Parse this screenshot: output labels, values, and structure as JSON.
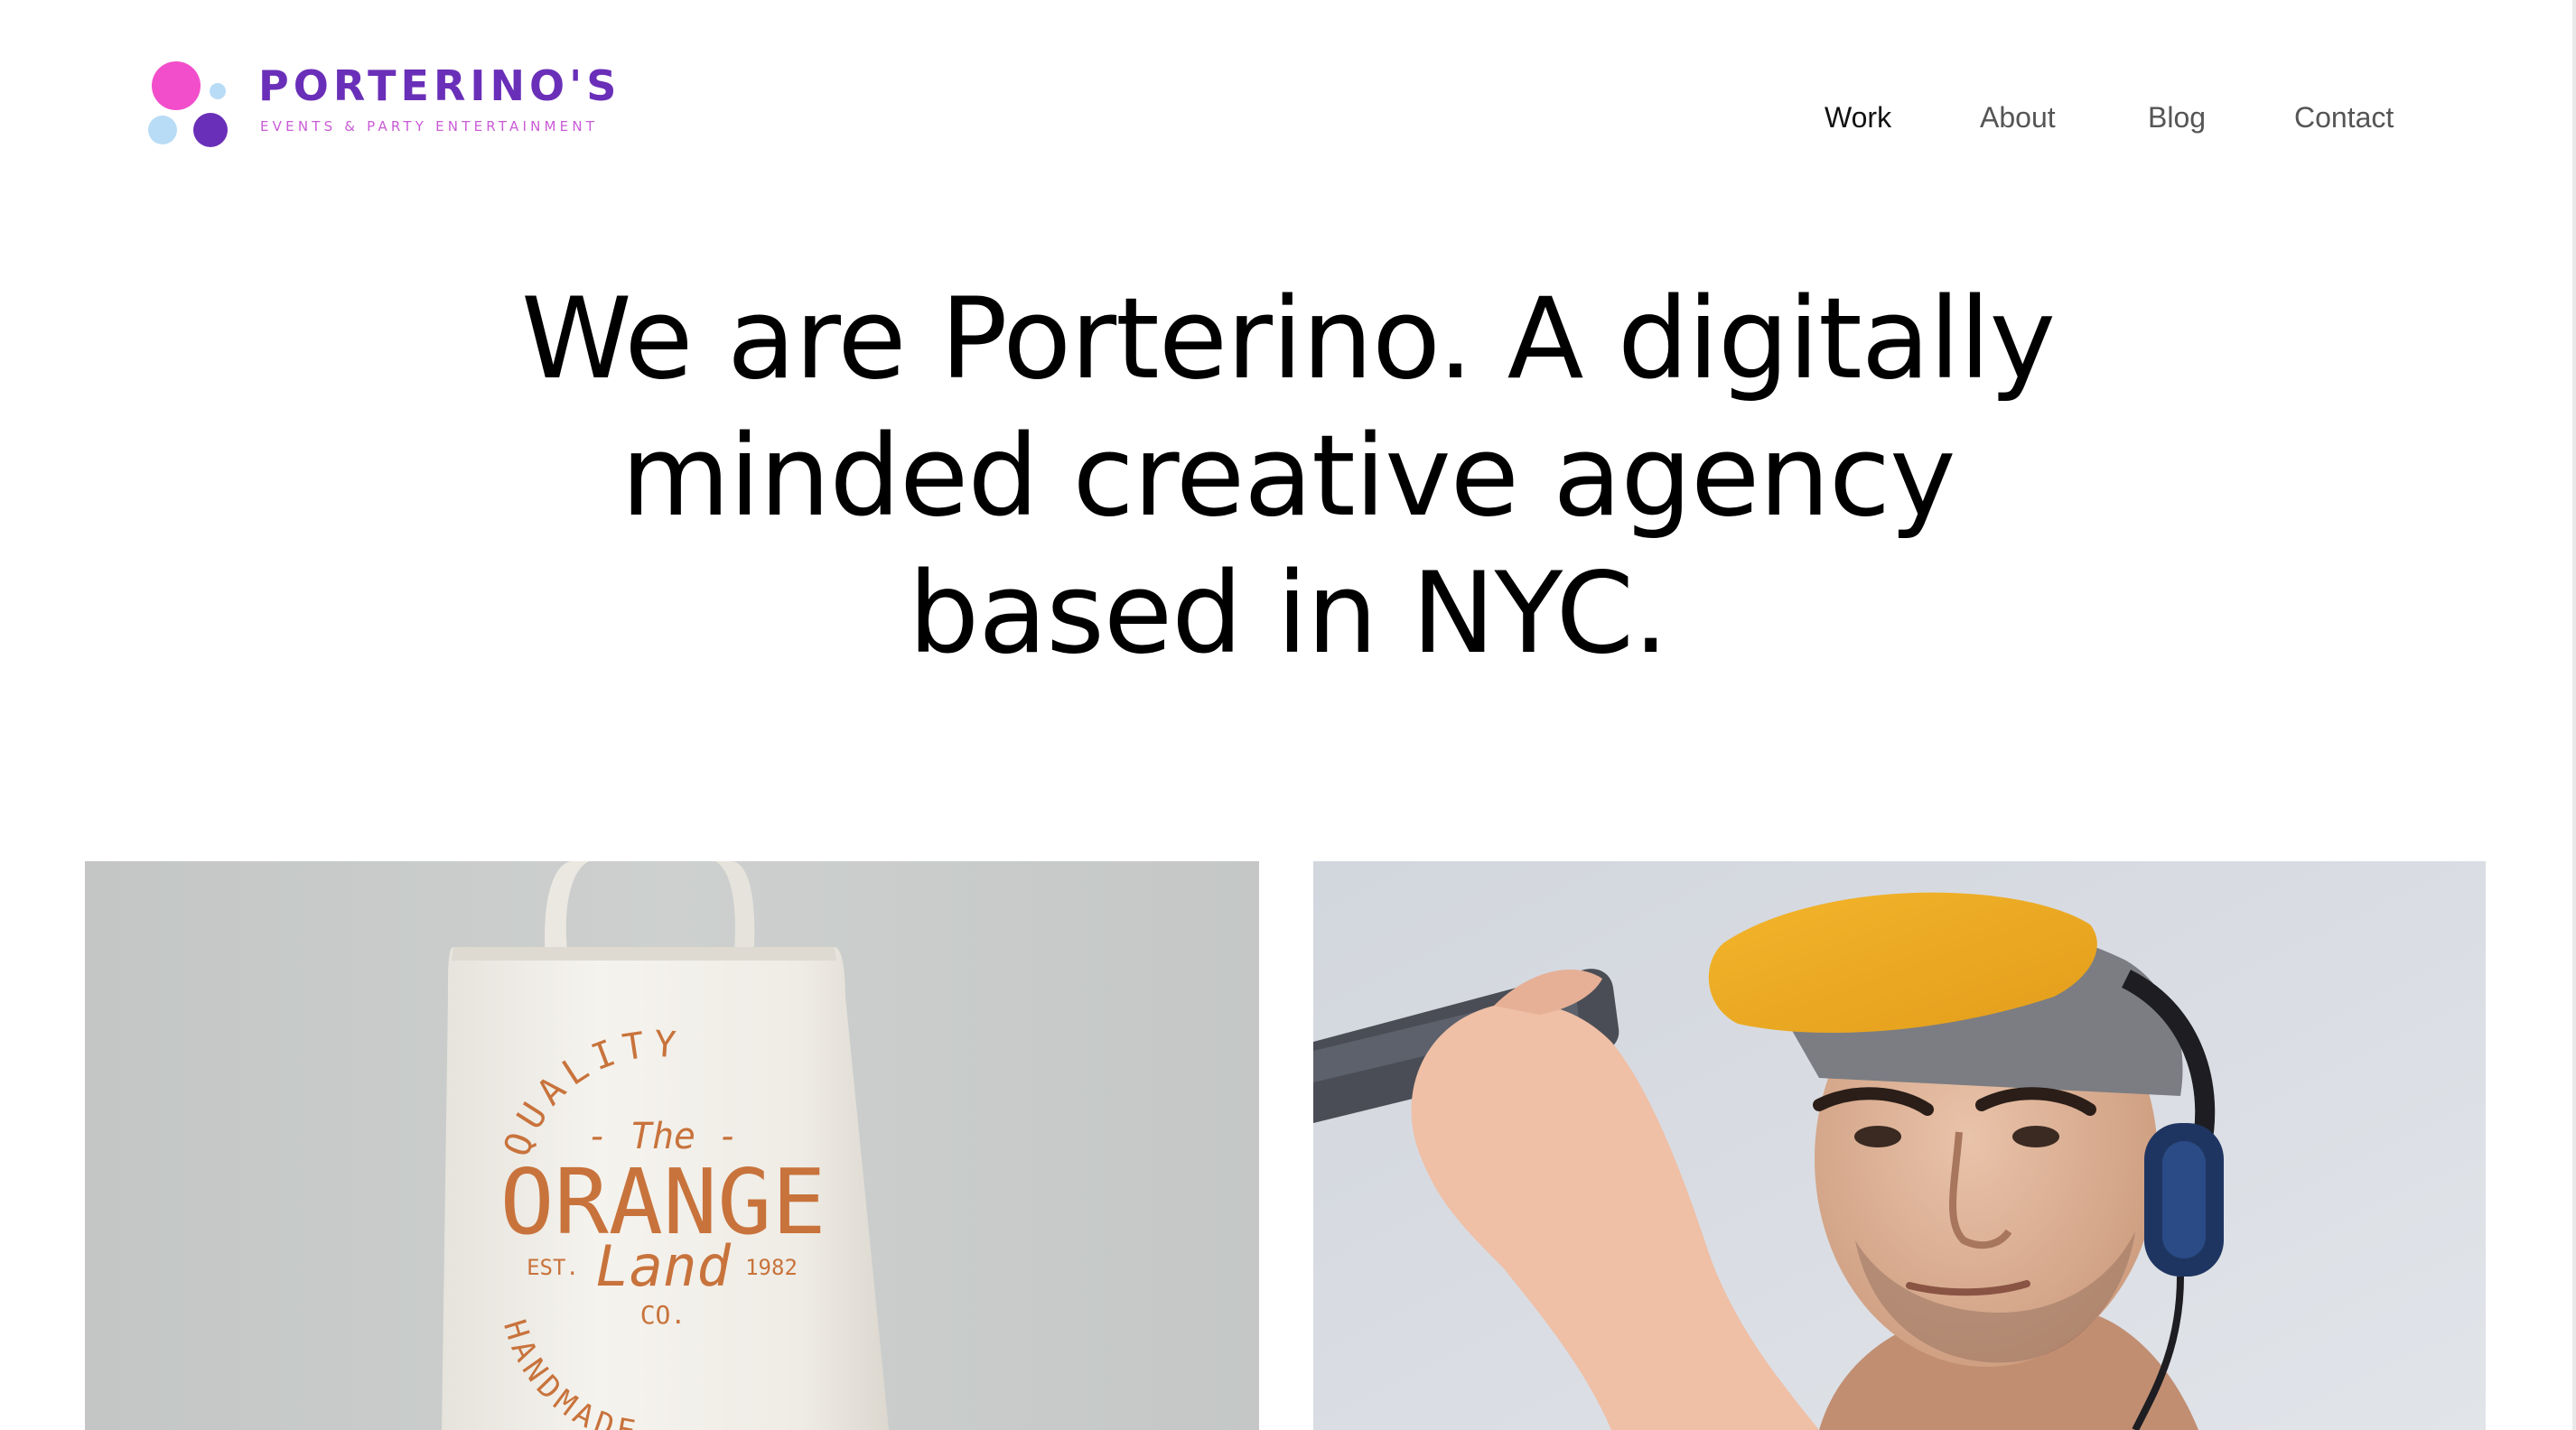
{
  "brand": {
    "name": "PORTERINO'S",
    "tagline": "EVENTS & PARTY ENTERTAINMENT",
    "colors": {
      "pink": "#f24ecb",
      "purple": "#6a2fb8",
      "light_blue": "#b9dcf6",
      "tagline": "#c95bd6"
    }
  },
  "nav": {
    "items": [
      {
        "label": "Work",
        "active": true
      },
      {
        "label": "About",
        "active": false
      },
      {
        "label": "Blog",
        "active": false
      },
      {
        "label": "Contact",
        "active": false
      }
    ]
  },
  "hero": {
    "lines": [
      "We are Porterino. A digitally",
      "minded creative agency",
      "based in NYC."
    ]
  },
  "work": {
    "items": [
      {
        "subject": "tote bag mockup",
        "print": {
          "top_arc": "QUALITY",
          "the": "- The -",
          "name": "ORANGE",
          "est": "EST.",
          "script": "Land",
          "year": "1982",
          "co": "CO.",
          "bottom_arc": "HANDMADE"
        }
      },
      {
        "subject": "man in yellow cap and headphones taking a phone photo"
      }
    ]
  }
}
